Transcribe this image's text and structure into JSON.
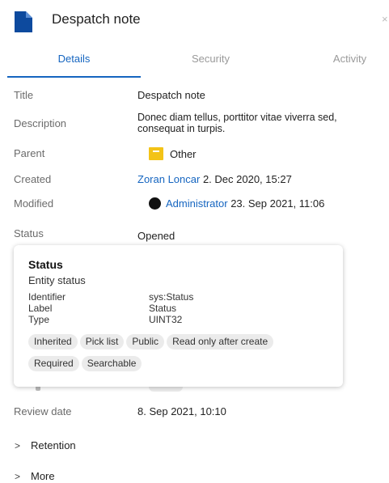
{
  "header": {
    "title": "Despatch note",
    "close_glyph": "×"
  },
  "tabs": [
    {
      "label": "Details",
      "active": true
    },
    {
      "label": "Security",
      "active": false
    },
    {
      "label": "Activity",
      "active": false
    }
  ],
  "fields": {
    "title": {
      "label": "Title",
      "value": "Despatch note"
    },
    "description": {
      "label": "Description",
      "value": "Donec diam tellus, porttitor vitae viverra sed, consequat in turpis."
    },
    "parent": {
      "label": "Parent",
      "value": "Other",
      "icon": "folder-icon"
    },
    "created": {
      "label": "Created",
      "user": "Zoran Loncar",
      "date": "2. Dec 2020, 15:27"
    },
    "modified": {
      "label": "Modified",
      "user": "Administrator",
      "date": "23. Sep 2021, 11:06"
    },
    "status": {
      "label": "Status",
      "value": "Opened"
    },
    "review_date": {
      "label": "Review date",
      "value": "8. Sep 2021, 10:10"
    }
  },
  "popup": {
    "title": "Status",
    "subtitle": "Entity status",
    "identifier_label": "Identifier",
    "identifier_value": "sys:Status",
    "label_label": "Label",
    "label_value": "Status",
    "type_label": "Type",
    "type_value": "UINT32",
    "chips_row1": [
      "Inherited",
      "Pick list",
      "Public",
      "Read only after create"
    ],
    "chips_row2": [
      "Required",
      "Searchable"
    ]
  },
  "sections": [
    {
      "label": "Retention"
    },
    {
      "label": "More"
    }
  ],
  "colors": {
    "accent": "#1565c0",
    "doc_icon": "#0d4a9e",
    "folder": "#f3c317"
  }
}
